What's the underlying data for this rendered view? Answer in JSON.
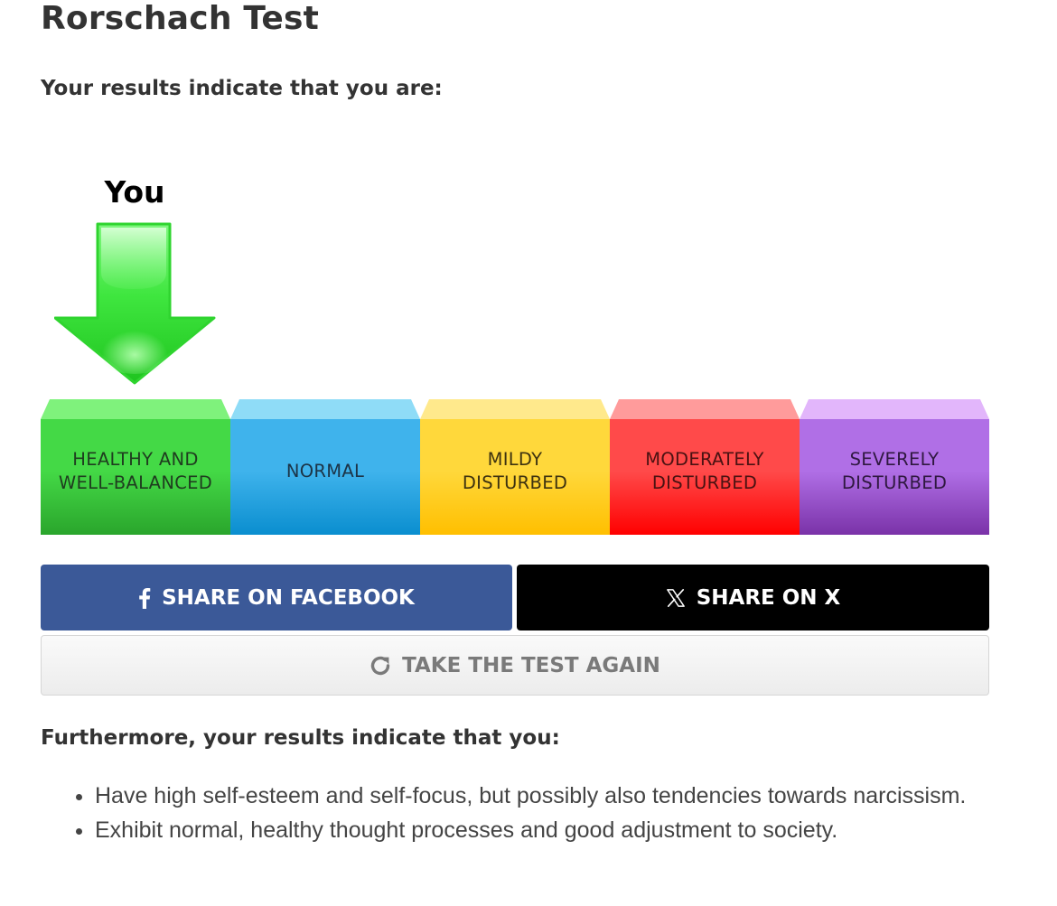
{
  "page": {
    "title": "Rorschach Test",
    "results_heading": "Your results indicate that you are:"
  },
  "graphic": {
    "you_label": "You",
    "pointer_color": "#39e23a",
    "selected_index": 0,
    "scale": [
      {
        "label": "HEALTHY AND\nWELL-BALANCED",
        "top_color": "#7ff27c",
        "color": "#44d946",
        "bottom_color": "#2aa52c",
        "text_color": "#1f3d1f"
      },
      {
        "label": "NORMAL",
        "top_color": "#8fdcf7",
        "color": "#3fb3ec",
        "bottom_color": "#0a8ecf",
        "text_color": "#1c3447"
      },
      {
        "label": "MILDY\nDISTURBED",
        "top_color": "#ffe98c",
        "color": "#ffd83b",
        "bottom_color": "#ffbf00",
        "text_color": "#3d3210"
      },
      {
        "label": "MODERATELY\nDISTURBED",
        "top_color": "#ff9b9b",
        "color": "#ff4a4a",
        "bottom_color": "#ff0000",
        "text_color": "#4a1212"
      },
      {
        "label": "SEVERELY\nDISTURBED",
        "top_color": "#e2b6fb",
        "color": "#b06fe6",
        "bottom_color": "#7a32a8",
        "text_color": "#2f1840"
      }
    ]
  },
  "share": {
    "facebook_label": "SHARE ON FACEBOOK",
    "facebook_icon": "facebook-icon",
    "x_label": "SHARE ON X",
    "x_icon": "x-logo-icon",
    "facebook_color": "#3b5998",
    "x_color": "#000000"
  },
  "retake": {
    "label": "TAKE THE TEST AGAIN",
    "icon": "refresh-icon"
  },
  "further": {
    "heading": "Furthermore, your results indicate that you:",
    "items": [
      "Have high self-esteem and self-focus, but possibly also tendencies towards narcissism.",
      "Exhibit normal, healthy thought processes and good adjustment to society."
    ]
  }
}
